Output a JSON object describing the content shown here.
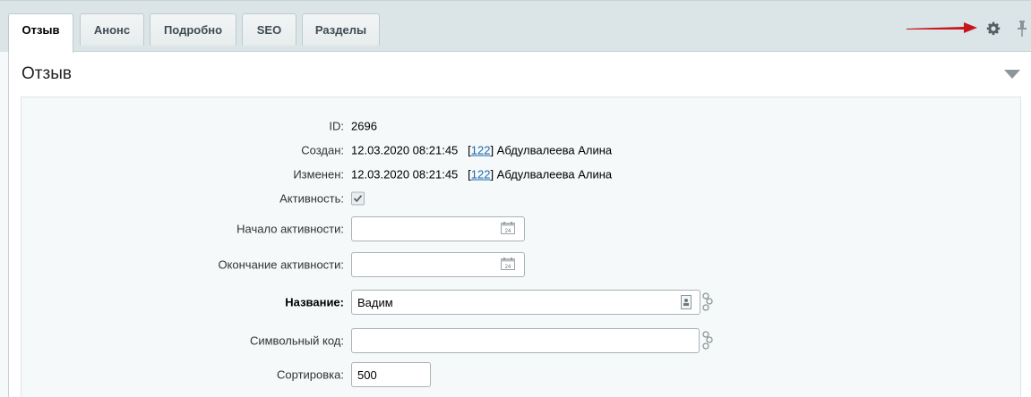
{
  "tabs": [
    {
      "label": "Отзыв",
      "active": true
    },
    {
      "label": "Анонс",
      "active": false
    },
    {
      "label": "Подробно",
      "active": false
    },
    {
      "label": "SEO",
      "active": false
    },
    {
      "label": "Разделы",
      "active": false
    }
  ],
  "toolbar": {
    "settings_icon": "gear-icon",
    "pin_icon": "pin-icon",
    "arrow_color": "#c8161d"
  },
  "panel": {
    "title": "Отзыв"
  },
  "form": {
    "id": {
      "label": "ID:",
      "value": "2696"
    },
    "created": {
      "label": "Создан:",
      "datetime": "12.03.2020 08:21:45",
      "user_id": "122",
      "user_name": "Абдулвалеева Алина"
    },
    "modified": {
      "label": "Изменен:",
      "datetime": "12.03.2020 08:21:45",
      "user_id": "122",
      "user_name": "Абдулвалеева Алина"
    },
    "active": {
      "label": "Активность:",
      "checked": true
    },
    "active_from": {
      "label": "Начало активности:",
      "value": ""
    },
    "active_to": {
      "label": "Окончание активности:",
      "value": ""
    },
    "name": {
      "label": "Название:",
      "value": "Вадим"
    },
    "code": {
      "label": "Символьный код:",
      "value": ""
    },
    "sort": {
      "label": "Сортировка:",
      "value": "500"
    }
  },
  "colors": {
    "link": "#2067b0",
    "tabbar_bg": "#dbe5e7",
    "form_bg": "#f5f9f9"
  }
}
